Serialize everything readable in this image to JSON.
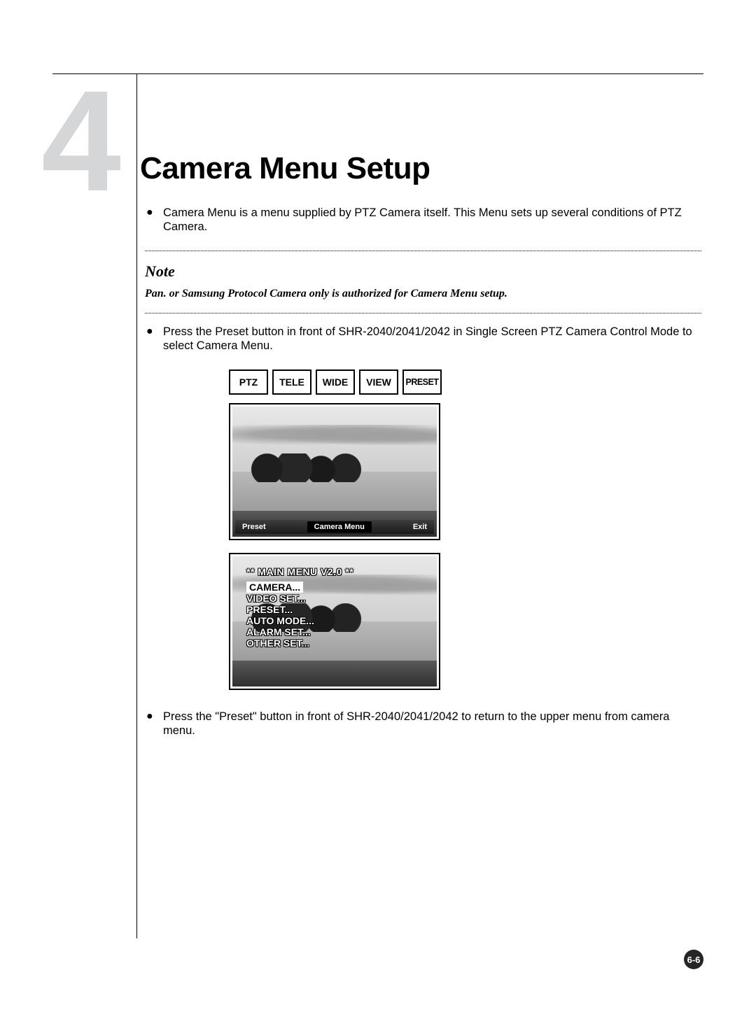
{
  "chapter_number": "4",
  "title": "Camera Menu Setup",
  "bullets": {
    "b1": "Camera Menu is a menu supplied by PTZ Camera itself. This Menu sets up several conditions of PTZ Camera.",
    "b2": "Press the Preset button in front of SHR-2040/2041/2042 in Single Screen PTZ Camera Control Mode to select Camera Menu.",
    "b3": "Press the \"Preset\" button in front of SHR-2040/2041/2042 to return to the upper menu from camera menu."
  },
  "note": {
    "heading": "Note",
    "body": "Pan. or Samsung Protocol Camera only is authorized for Camera Menu setup."
  },
  "buttons": {
    "ptz": "PTZ",
    "tele": "TELE",
    "wide": "WIDE",
    "view": "VIEW",
    "preset": "PRESET"
  },
  "screenshot1": {
    "bottom_left": "Preset",
    "bottom_mid": "Camera Menu",
    "bottom_right": "Exit"
  },
  "screenshot2": {
    "heading": "** MAIN MENU V2.0 **",
    "items": {
      "i1": "CAMERA...",
      "i2": "VIDEO SET...",
      "i3": "PRESET...",
      "i4": "AUTO MODE...",
      "i5": "ALARM SET...",
      "i6": "OTHER SET..."
    }
  },
  "page_number": "6-6"
}
